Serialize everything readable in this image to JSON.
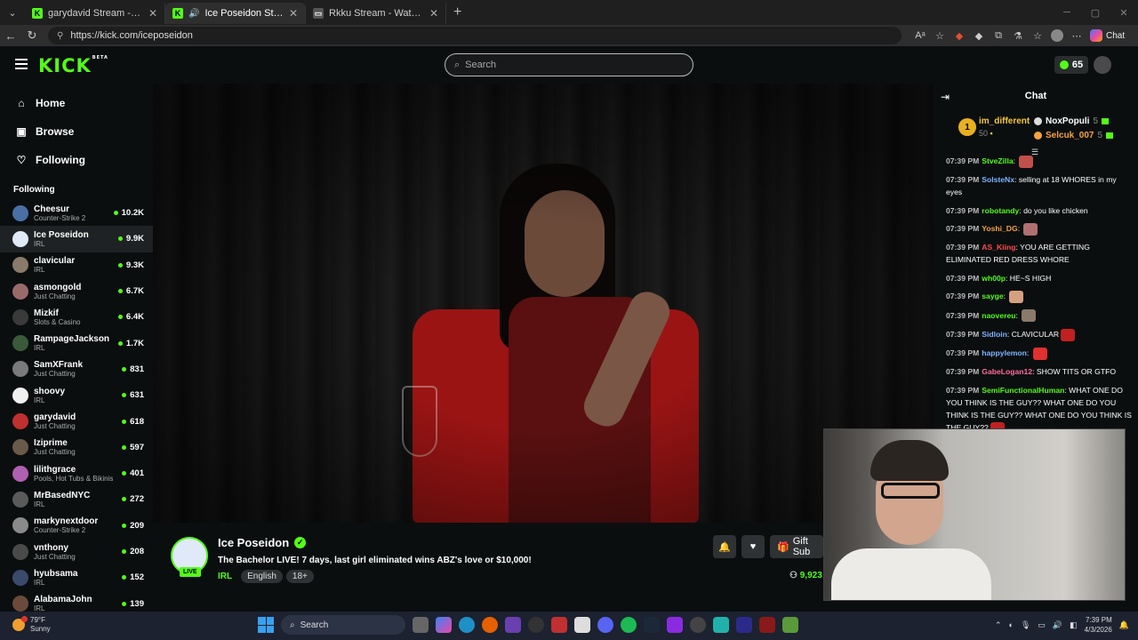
{
  "browser": {
    "tabs": [
      {
        "title": "garydavid Stream - Watch Live on Kick"
      },
      {
        "title": "Ice Poseidon Stream - Watch Live on Kick"
      },
      {
        "title": "Rkku Stream - Watch Live on Kick"
      }
    ],
    "url": "https://kick.com/iceposeidon",
    "chat_label": "Chat"
  },
  "header": {
    "logo": "KICK",
    "logo_beta": "BETA",
    "search_placeholder": "Search",
    "kicks_count": "65"
  },
  "sidebar": {
    "nav": [
      {
        "label": "Home",
        "icon": "home-icon"
      },
      {
        "label": "Browse",
        "icon": "browse-icon"
      },
      {
        "label": "Following",
        "icon": "heart-icon"
      }
    ],
    "following_title": "Following",
    "following": [
      {
        "name": "Cheesur",
        "category": "Counter-Strike 2",
        "viewers": "10.2K",
        "color": "#4a6fa5"
      },
      {
        "name": "Ice Poseidon",
        "category": "IRL",
        "viewers": "9.9K",
        "color": "#dfe9f7"
      },
      {
        "name": "clavicular",
        "category": "IRL",
        "viewers": "9.3K",
        "color": "#8a7a6a"
      },
      {
        "name": "asmongold",
        "category": "Just Chatting",
        "viewers": "6.7K",
        "color": "#9a6a6a"
      },
      {
        "name": "Mizkif",
        "category": "Slots & Casino",
        "viewers": "6.4K",
        "color": "#3a3a3a"
      },
      {
        "name": "RampageJackson",
        "category": "IRL",
        "viewers": "1.7K",
        "color": "#3a5a3a"
      },
      {
        "name": "SamXFrank",
        "category": "Just Chatting",
        "viewers": "831",
        "color": "#7a7a7a"
      },
      {
        "name": "shoovy",
        "category": "IRL",
        "viewers": "631",
        "color": "#f0f0f0"
      },
      {
        "name": "garydavid",
        "category": "Just Chatting",
        "viewers": "618",
        "color": "#c03030"
      },
      {
        "name": "Iziprime",
        "category": "Just Chatting",
        "viewers": "597",
        "color": "#6a5a4a"
      },
      {
        "name": "lilithgrace",
        "category": "Pools, Hot Tubs & Bikinis",
        "viewers": "401",
        "color": "#b060b0"
      },
      {
        "name": "MrBasedNYC",
        "category": "IRL",
        "viewers": "272",
        "color": "#5a5a5a"
      },
      {
        "name": "markynextdoor",
        "category": "Counter-Strike 2",
        "viewers": "209",
        "color": "#8a8a8a"
      },
      {
        "name": "vnthony",
        "category": "Just Chatting",
        "viewers": "208",
        "color": "#4a4a4a"
      },
      {
        "name": "hyubsama",
        "category": "IRL",
        "viewers": "152",
        "color": "#3a4a6a"
      },
      {
        "name": "AlabamaJohn",
        "category": "IRL",
        "viewers": "139",
        "color": "#6a4a3a"
      }
    ]
  },
  "stream": {
    "name": "Ice Poseidon",
    "title": "The Bachelor LIVE! 7 days, last girl eliminated wins ABZ's love or $10,000!",
    "category": "IRL",
    "tags": [
      "English",
      "18+"
    ],
    "live_label": "LIVE",
    "gift_label": "Gift Sub",
    "viewers": "9,923"
  },
  "chat": {
    "title": "Chat",
    "gifters": {
      "top": {
        "rank": "1",
        "name": "im_different",
        "count": "50"
      },
      "others": [
        {
          "name": "NoxPopuli",
          "count": "5",
          "color": "#ffffff"
        },
        {
          "name": "Selcuk_007",
          "count": "5",
          "color": "#f5a342"
        }
      ]
    },
    "messages": [
      {
        "time": "07:39 PM",
        "user": "StveZilla",
        "color": "#53fc18",
        "text": "",
        "emote": "#c0504a"
      },
      {
        "time": "07:39 PM",
        "user": "SolsteNx",
        "color": "#7fb3ff",
        "text": "selling at 18 WHORES in my eyes",
        "emote": ""
      },
      {
        "time": "07:39 PM",
        "user": "robotandy",
        "color": "#53fc18",
        "text": "do you like chicken",
        "emote": ""
      },
      {
        "time": "07:39 PM",
        "user": "Yoshi_DG",
        "color": "#f5a342",
        "text": "",
        "emote": "#b07070"
      },
      {
        "time": "07:39 PM",
        "user": "AS_Kiing",
        "color": "#ff4d4d",
        "text": "YOU ARE GETTING ELIMINATED RED DRESS WHORE",
        "emote": ""
      },
      {
        "time": "07:39 PM",
        "user": "wh00p",
        "color": "#53fc18",
        "text": "HE~S HIGH",
        "emote": ""
      },
      {
        "time": "07:39 PM",
        "user": "sayge",
        "color": "#53fc18",
        "text": "",
        "emote": "#d4a080"
      },
      {
        "time": "07:39 PM",
        "user": "naovereu",
        "color": "#53fc18",
        "text": "",
        "emote": "#8a7a6a"
      },
      {
        "time": "07:39 PM",
        "user": "Sidloin",
        "color": "#7fb3ff",
        "text": "CLAVICULAR",
        "emote": "#c02020"
      },
      {
        "time": "07:39 PM",
        "user": "happylemon",
        "color": "#7fb3ff",
        "text": "",
        "emote": "#e03030"
      },
      {
        "time": "07:39 PM",
        "user": "GabeLogan12",
        "color": "#ff6b9d",
        "text": "SHOW TITS OR GTFO",
        "emote": ""
      },
      {
        "time": "07:39 PM",
        "user": "SemiFunctionalHuman",
        "color": "#53fc18",
        "text": "WHAT ONE DO YOU THINK IS THE GUY?? WHAT ONE DO YOU THINK IS THE GUY?? WHAT ONE DO YOU THINK IS THE GUY??",
        "emote": "#c02020"
      }
    ]
  },
  "taskbar": {
    "temp": "79°F",
    "condition": "Sunny",
    "search_placeholder": "Search",
    "time": "7:39 PM",
    "date": "4/3/2026"
  }
}
